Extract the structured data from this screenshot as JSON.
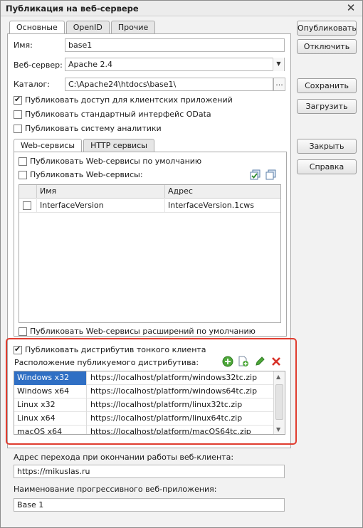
{
  "window": {
    "title": "Публикация на веб-сервере",
    "close_glyph": "✕"
  },
  "main_tabs": [
    {
      "label": "Основные",
      "active": true
    },
    {
      "label": "OpenID",
      "active": false
    },
    {
      "label": "Прочие",
      "active": false
    }
  ],
  "form": {
    "name_label": "Имя:",
    "name_value": "base1",
    "server_label": "Веб-сервер:",
    "server_value": "Apache 2.4",
    "catalog_label": "Каталог:",
    "catalog_value": "C:\\Apache24\\htdocs\\base1\\",
    "catalog_button": "...",
    "checks": [
      {
        "label": "Публиковать доступ для клиентских приложений",
        "checked": true
      },
      {
        "label": "Публиковать стандартный интерфейс OData",
        "checked": false
      },
      {
        "label": "Публиковать систему аналитики",
        "checked": false
      }
    ]
  },
  "buttons": {
    "publish": "Опубликовать",
    "disable": "Отключить",
    "save": "Сохранить",
    "load": "Загрузить",
    "close": "Закрыть",
    "help": "Справка"
  },
  "service_tabs": [
    {
      "label": "Web-сервисы",
      "active": true
    },
    {
      "label": "HTTP сервисы",
      "active": false
    }
  ],
  "web_services": {
    "default_check": "Публиковать Web-сервисы по умолчанию",
    "publish_check": "Публиковать Web-сервисы:",
    "columns": [
      "Имя",
      "Адрес"
    ],
    "rows": [
      {
        "checked": false,
        "name": "InterfaceVersion",
        "address": "InterfaceVersion.1cws"
      }
    ],
    "ext_check": "Публиковать Web-сервисы расширений по умолчанию"
  },
  "distribution": {
    "publish_check": "Публиковать дистрибутив тонкого клиента",
    "publish_checked": true,
    "location_label": "Расположение публикуемого дистрибутива:",
    "rows": [
      {
        "os": "Windows x32",
        "url": "https://localhost/platform/windows32tc.zip",
        "selected": true
      },
      {
        "os": "Windows x64",
        "url": "https://localhost/platform/windows64tc.zip",
        "selected": false
      },
      {
        "os": "Linux x32",
        "url": "https://localhost/platform/linux32tc.zip",
        "selected": false
      },
      {
        "os": "Linux x64",
        "url": "https://localhost/platform/linux64tc.zip",
        "selected": false
      },
      {
        "os": "macOS x64",
        "url": "https://localhost/platform/macOS64tc.zip",
        "selected": false
      }
    ]
  },
  "footer": {
    "redirect_label": "Адрес перехода при окончании работы веб-клиента:",
    "redirect_value": "https://mikuslas.ru",
    "pwa_label": "Наименование прогрессивного веб-приложения:",
    "pwa_value": "Base 1"
  },
  "colors": {
    "highlight_frame": "#e03c2f",
    "selected_row": "#2f6fc4"
  }
}
